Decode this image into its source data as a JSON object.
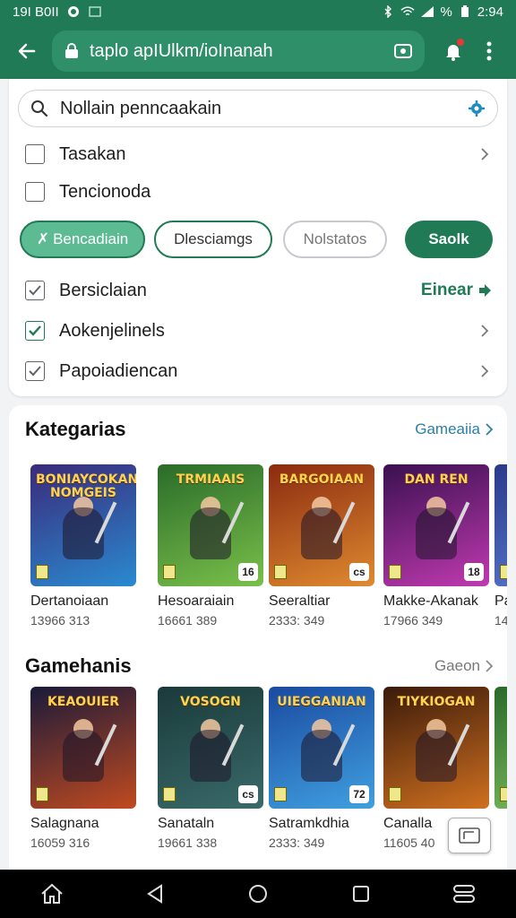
{
  "status_bar": {
    "left_text": "19I B0II",
    "time": "2:94",
    "battery": "%"
  },
  "app_bar": {
    "url": "taplo apIUlkm/ioInanah"
  },
  "filter": {
    "search_text": "Nollain penncaakain",
    "top_checks": [
      {
        "label": "Tasakan"
      },
      {
        "label": "Tencionoda"
      }
    ],
    "chips": [
      {
        "label": "Bencadiain",
        "state": "active"
      },
      {
        "label": "Dlesciamgs",
        "state": "outline"
      },
      {
        "label": "Nolstatos",
        "state": "muted"
      },
      {
        "label": "Saolk",
        "state": "primary"
      }
    ],
    "options": [
      {
        "label": "Bersiclaian",
        "checked": true,
        "link": "Einear"
      },
      {
        "label": "Aokenjelinels",
        "checked": true,
        "accent": true
      },
      {
        "label": "Papoiadiencan",
        "checked": true
      }
    ]
  },
  "sections": [
    {
      "title": "Kategarias",
      "link": "Gameaiia",
      "games": [
        {
          "name": "Dertanoiaan",
          "meta": "13966 313",
          "art_title": "BONIAYCOKAN NOMGEIS",
          "badge": "",
          "colors": [
            "#3a2a7a",
            "#2a8ad0"
          ]
        },
        {
          "name": "Hesoaraiain",
          "meta": "16661 389",
          "art_title": "TRMIAAIS",
          "badge": "16",
          "colors": [
            "#2a6b2a",
            "#7ac04a"
          ]
        },
        {
          "name": "Seeraltiar",
          "meta": "2333: 349",
          "art_title": "BARGOIAAN",
          "badge": "cs",
          "colors": [
            "#8a2a10",
            "#e08a30"
          ]
        },
        {
          "name": "Makke-Akanak",
          "meta": "17966 349",
          "art_title": "DAN REN",
          "badge": "18",
          "colors": [
            "#3a1050",
            "#c03ab0"
          ]
        },
        {
          "name": "Pa",
          "meta": "14",
          "art_title": "",
          "badge": "",
          "colors": [
            "#2a3a8a",
            "#5a7ad0"
          ]
        }
      ]
    },
    {
      "title": "Gamehanis",
      "link": "Gaeon",
      "games": [
        {
          "name": "Salagnana",
          "meta": "16059 316",
          "art_title": "KEAOUIER",
          "badge": "",
          "colors": [
            "#1a1a3a",
            "#c04a20"
          ]
        },
        {
          "name": "Sanataln",
          "meta": "19661 338",
          "art_title": "VOSOGN",
          "badge": "cs",
          "colors": [
            "#1a3a3a",
            "#3a6a6a"
          ]
        },
        {
          "name": "Satramkdhia",
          "meta": "2333: 349",
          "art_title": "UIEGGANIAN",
          "badge": "72",
          "colors": [
            "#1a4aa0",
            "#40a0e0"
          ]
        },
        {
          "name": "Canalla",
          "meta": "11605 40",
          "art_title": "TIYKIOGAN",
          "badge": "",
          "colors": [
            "#3a1a0a",
            "#d07020"
          ]
        },
        {
          "name": "",
          "meta": "",
          "art_title": "",
          "badge": "",
          "colors": [
            "#2a6a2a",
            "#80c060"
          ]
        }
      ]
    }
  ],
  "icons": {
    "back": "arrow-left-icon",
    "lock": "lock-icon",
    "tabs": "tabs-icon",
    "notif": "bell-icon",
    "menu": "more-vert-icon",
    "search": "search-icon",
    "settings": "gear-icon",
    "home": "home-icon",
    "back_nav": "back-triangle-icon",
    "circle": "home-circle-icon",
    "recents": "square-icon",
    "menu_nav": "menu-icon"
  },
  "colors": {
    "brand": "#1f7a55",
    "chip_active": "#5dbb93",
    "link": "#2a7fa8"
  }
}
